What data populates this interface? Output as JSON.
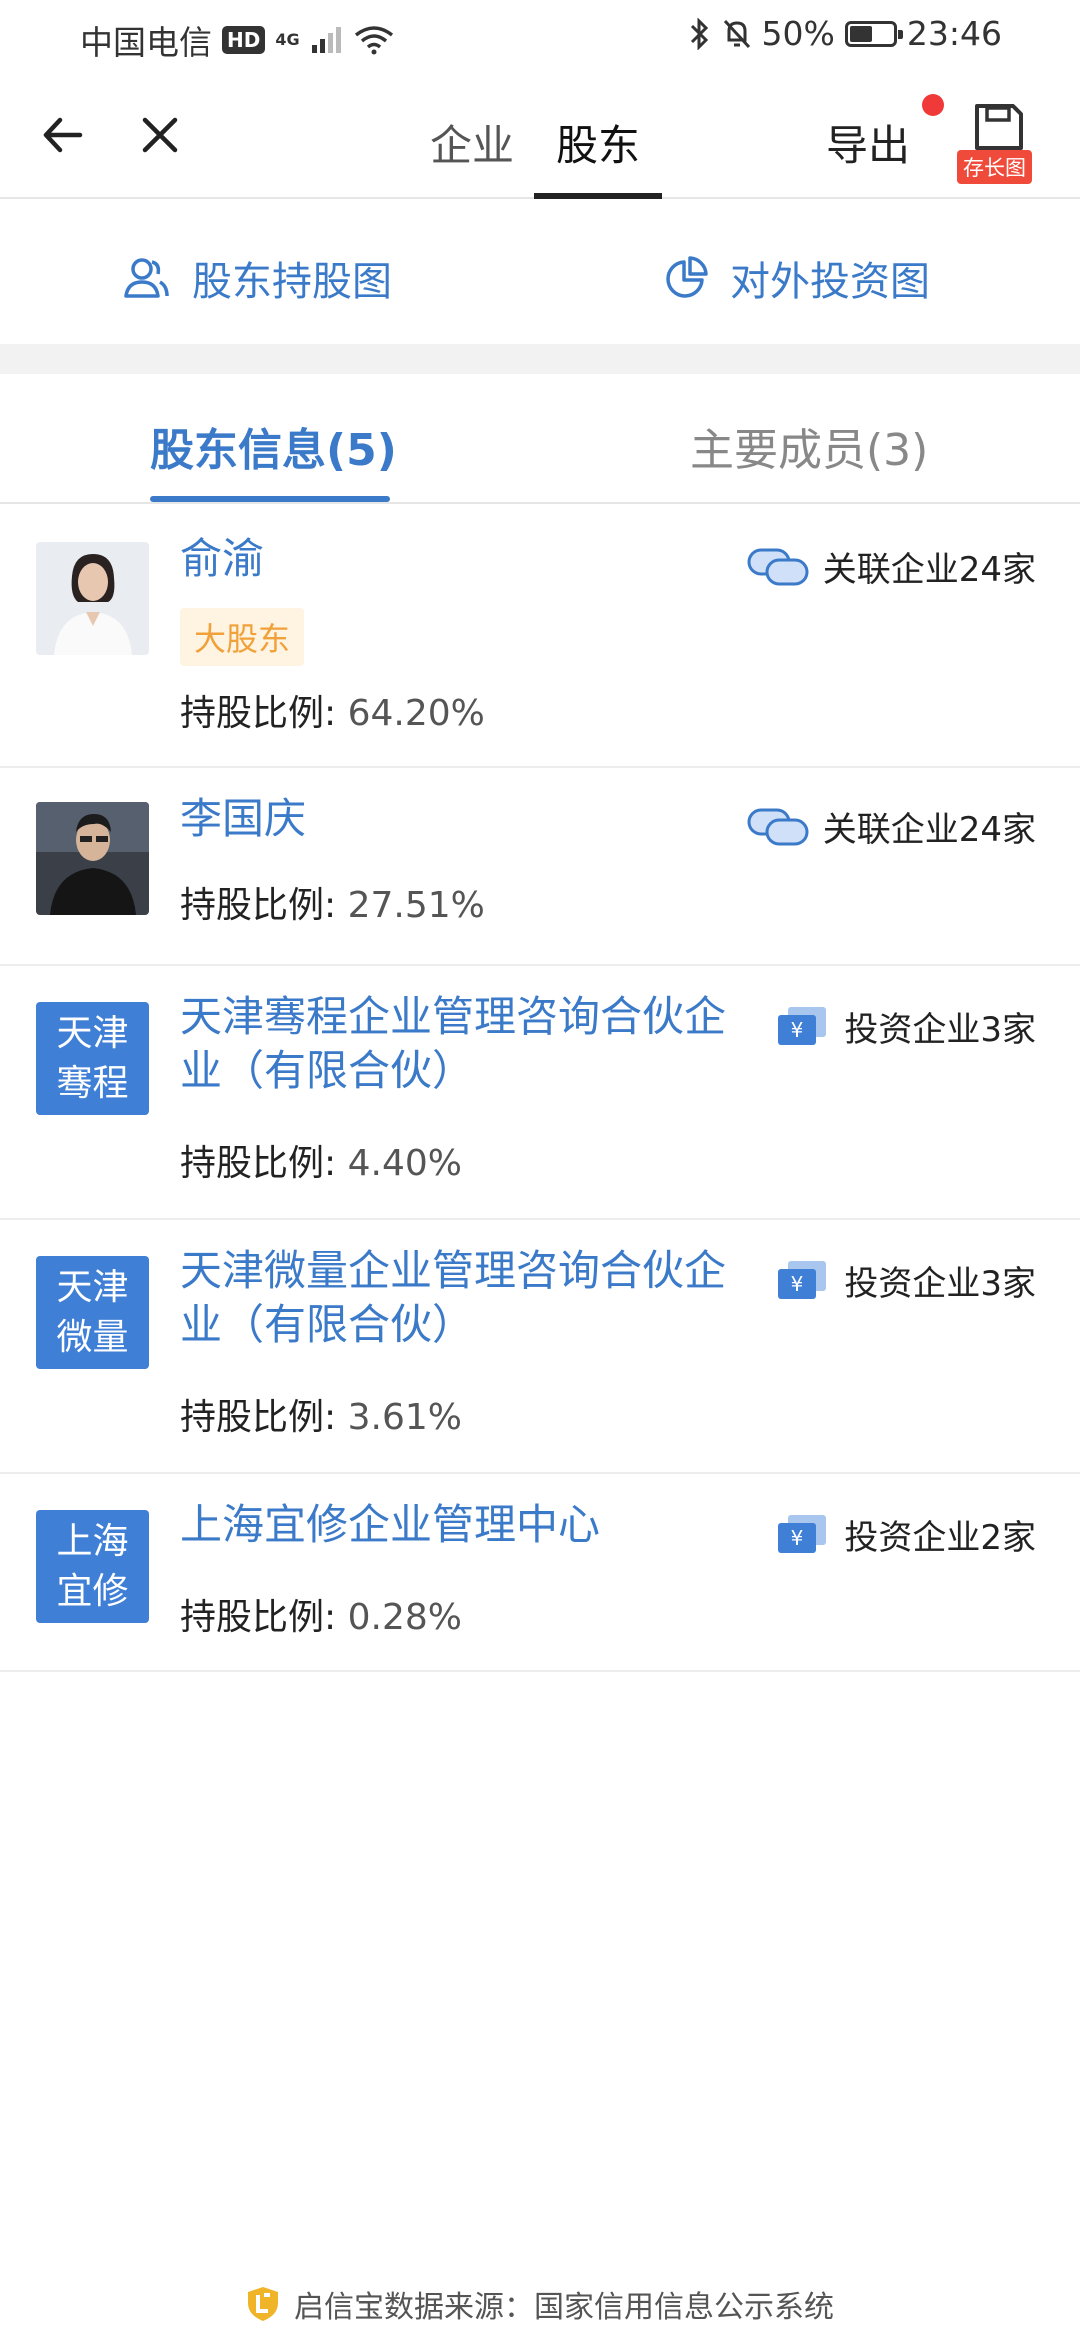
{
  "status": {
    "carrier": "中国电信",
    "hd": "HD",
    "net": "4G",
    "battery_text": "50%",
    "battery_level": 0.5,
    "time": "23:46"
  },
  "nav": {
    "tabs": [
      {
        "label": "企业"
      },
      {
        "label": "股东"
      }
    ],
    "export": "导出",
    "save_badge": "存长图"
  },
  "links": {
    "left": "股东持股图",
    "right": "对外投资图"
  },
  "subtabs": {
    "tab1": "股东信息(5)",
    "tab2": "主要成员(3)"
  },
  "shareholders": [
    {
      "name": "俞渝",
      "badge": "大股东",
      "ratio_label": "持股比例:",
      "ratio": "64.20%",
      "rel": "关联企业24家",
      "rel_icon": "people-link-icon"
    },
    {
      "name": "李国庆",
      "ratio_label": "持股比例:",
      "ratio": "27.51%",
      "rel": "关联企业24家",
      "rel_icon": "people-link-icon"
    },
    {
      "avatar_text": [
        "天津",
        "骞程"
      ],
      "name": "天津骞程企业管理咨询合伙企业（有限合伙）",
      "ratio_label": "持股比例:",
      "ratio": "4.40%",
      "rel": "投资企业3家",
      "rel_icon": "yuan-invest-icon"
    },
    {
      "avatar_text": [
        "天津",
        "微量"
      ],
      "name": "天津微量企业管理咨询合伙企业（有限合伙）",
      "ratio_label": "持股比例:",
      "ratio": "3.61%",
      "rel": "投资企业3家",
      "rel_icon": "yuan-invest-icon"
    },
    {
      "avatar_text": [
        "上海",
        "宜修"
      ],
      "name": "上海宜修企业管理中心",
      "ratio_label": "持股比例:",
      "ratio": "0.28%",
      "rel": "投资企业2家",
      "rel_icon": "yuan-invest-icon"
    }
  ],
  "footer": "启信宝数据来源：国家信用信息公示系统",
  "colors": {
    "accent": "#3b7ac9",
    "badge_bg": "#fff4e2",
    "badge_text": "#f0a13a",
    "avatar_bg": "#3f7fd6",
    "alert_dot": "#f03a3a"
  }
}
